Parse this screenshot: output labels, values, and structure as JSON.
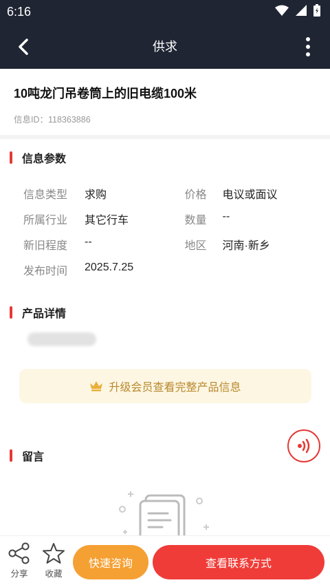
{
  "status_bar": {
    "time": "6:16"
  },
  "app_bar": {
    "title": "供求"
  },
  "product": {
    "title": "10吨龙门吊卷筒上的旧电缆100米",
    "info_id": "信息ID：118363886"
  },
  "params_section": {
    "heading": "信息参数",
    "rows": [
      {
        "left_key": "信息类型",
        "left_value": "求购",
        "right_key": "价格",
        "right_value": "电议或面议"
      },
      {
        "left_key": "所属行业",
        "left_value": "其它行车",
        "right_key": "数量",
        "right_value": "--"
      },
      {
        "left_key": "新旧程度",
        "left_value": "--",
        "right_key": "地区",
        "right_value": "河南·新乡"
      },
      {
        "left_key": "发布时间",
        "left_value": "2025.7.25",
        "right_key": "",
        "right_value": ""
      }
    ]
  },
  "details_section": {
    "heading": "产品详情",
    "upgrade_text": "升级会员查看完整产品信息"
  },
  "messages_section": {
    "heading": "留言"
  },
  "bottom_bar": {
    "share_label": "分享",
    "favorite_label": "收藏",
    "quick_consult_label": "快速咨询",
    "view_contact_label": "查看联系方式"
  },
  "colors": {
    "header_bg": "#1f2533",
    "accent_red": "#f03c38",
    "accent_orange": "#f5a033",
    "upgrade_bg": "#fdf6e3",
    "upgrade_text": "#b8892c"
  },
  "icons": [
    "wifi-icon",
    "signal-icon",
    "battery-icon",
    "back-arrow-icon",
    "more-vertical-icon",
    "crown-icon",
    "voice-icon",
    "empty-document-icon",
    "share-icon",
    "star-icon"
  ]
}
